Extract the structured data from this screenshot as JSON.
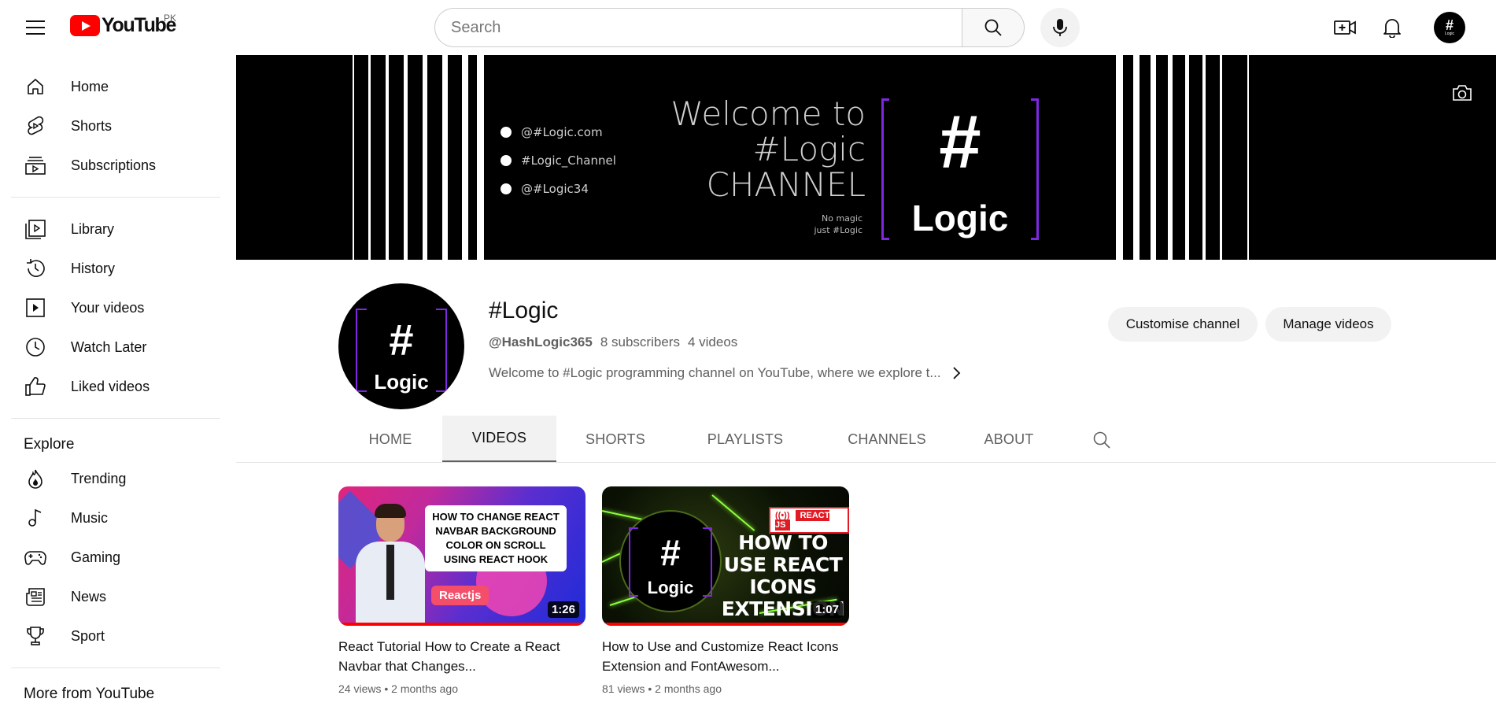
{
  "header": {
    "logo_text": "YouTube",
    "country_code": "PK",
    "search_placeholder": "Search",
    "avatar_hash": "#",
    "avatar_label": "Logic"
  },
  "sidebar": {
    "main": [
      {
        "label": "Home",
        "icon": "home-icon"
      },
      {
        "label": "Shorts",
        "icon": "shorts-icon"
      },
      {
        "label": "Subscriptions",
        "icon": "subscriptions-icon"
      }
    ],
    "you": [
      {
        "label": "Library",
        "icon": "library-icon"
      },
      {
        "label": "History",
        "icon": "history-icon"
      },
      {
        "label": "Your videos",
        "icon": "your-videos-icon"
      },
      {
        "label": "Watch Later",
        "icon": "watch-later-icon"
      },
      {
        "label": "Liked videos",
        "icon": "liked-icon"
      }
    ],
    "explore_heading": "Explore",
    "explore": [
      {
        "label": "Trending",
        "icon": "trending-icon"
      },
      {
        "label": "Music",
        "icon": "music-icon"
      },
      {
        "label": "Gaming",
        "icon": "gaming-icon"
      },
      {
        "label": "News",
        "icon": "news-icon"
      },
      {
        "label": "Sport",
        "icon": "sport-icon"
      }
    ],
    "more_heading": "More from YouTube"
  },
  "banner": {
    "links": [
      "@#Logic.com",
      "#Logic_Channel",
      "@#Logic34"
    ],
    "welcome_line1": "Welcome to",
    "welcome_line2": "#Logic",
    "welcome_line3": "CHANNEL",
    "tagline_line1": "No magic",
    "tagline_line2": "just #Logic",
    "logo_hash": "#",
    "logo_word": "Logic"
  },
  "channel": {
    "avatar_hash": "#",
    "avatar_word": "Logic",
    "name": "#Logic",
    "handle": "@HashLogic365",
    "subscribers": "8 subscribers",
    "videos_count": "4 videos",
    "description": "Welcome to #Logic programming channel on YouTube, where we explore t...",
    "customise_label": "Customise channel",
    "manage_label": "Manage videos"
  },
  "tabs": [
    {
      "label": "HOME",
      "active": false
    },
    {
      "label": "VIDEOS",
      "active": true
    },
    {
      "label": "SHORTS",
      "active": false
    },
    {
      "label": "PLAYLISTS",
      "active": false
    },
    {
      "label": "CHANNELS",
      "active": false
    },
    {
      "label": "ABOUT",
      "active": false
    }
  ],
  "videos": [
    {
      "title": "React Tutorial How to Create a React Navbar that Changes...",
      "views": "24 views",
      "age": "2 months ago",
      "duration": "1:26",
      "thumb_card": "HOW TO CHANGE REACT NAVBAR BACKGROUND COLOR ON SCROLL USING REACT HOOK",
      "thumb_pill": "Reactjs"
    },
    {
      "title": "How to Use and Customize React Icons Extension and FontAwesom...",
      "views": "81 views",
      "age": "2 months ago",
      "duration": "1:07",
      "thumb_badge": "REACT JS",
      "thumb_big": "HOW TO USE REACT ICONS EXTENSION",
      "thumb_hash": "#",
      "thumb_word": "Logic"
    }
  ],
  "colors": {
    "brand_red": "#ff0000",
    "logic_purple": "#7e28e0",
    "muted_text": "#606060"
  }
}
